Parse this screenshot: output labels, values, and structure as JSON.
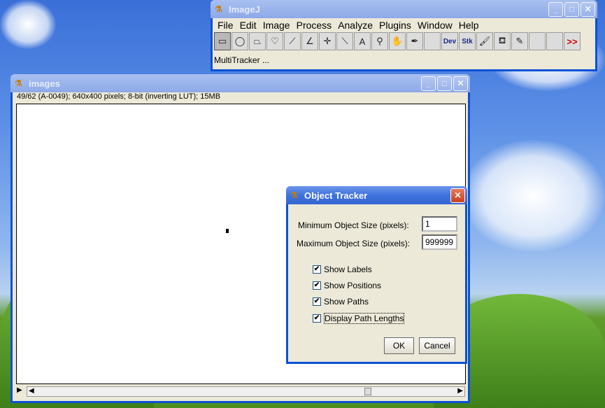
{
  "imagej": {
    "title": "ImageJ",
    "menu": [
      "File",
      "Edit",
      "Image",
      "Process",
      "Analyze",
      "Plugins",
      "Window",
      "Help"
    ],
    "tools": [
      {
        "name": "rectangle-tool-icon",
        "glyph": "▭",
        "sel": true
      },
      {
        "name": "oval-tool-icon",
        "glyph": "◯"
      },
      {
        "name": "polygon-tool-icon",
        "glyph": "⏢"
      },
      {
        "name": "freehand-tool-icon",
        "glyph": "♡"
      },
      {
        "name": "line-tool-icon",
        "glyph": "⟋"
      },
      {
        "name": "angle-tool-icon",
        "glyph": "∠"
      },
      {
        "name": "point-tool-icon",
        "glyph": "✛"
      },
      {
        "name": "wand-tool-icon",
        "glyph": "⟍"
      },
      {
        "name": "text-tool-icon",
        "glyph": "A"
      },
      {
        "name": "magnifier-tool-icon",
        "glyph": "⚲"
      },
      {
        "name": "hand-tool-icon",
        "glyph": "✋"
      },
      {
        "name": "dropper-tool-icon",
        "glyph": "✒"
      },
      {
        "name": "empty-tool",
        "glyph": ""
      },
      {
        "name": "dev-tool",
        "glyph": "Dev",
        "txt": true
      },
      {
        "name": "stk-tool",
        "glyph": "Stk",
        "txt": true
      },
      {
        "name": "brush-tool-icon",
        "glyph": "🖌"
      },
      {
        "name": "flood-fill-tool-icon",
        "glyph": "⛾"
      },
      {
        "name": "pencil-tool-icon",
        "glyph": "✎"
      },
      {
        "name": "empty-tool",
        "glyph": ""
      },
      {
        "name": "empty-tool",
        "glyph": ""
      },
      {
        "name": "more-tools-icon",
        "glyph": ">>",
        "more": true
      }
    ],
    "status": "MultiTracker ..."
  },
  "image_window": {
    "title": "images",
    "info": "49/62 (A-0049); 640x400 pixels; 8-bit (inverting LUT); 15MB"
  },
  "dialog": {
    "title": "Object Tracker",
    "min_label": "Minimum Object Size (pixels):",
    "min_value": "1",
    "max_label": "Maximum Object Size (pixels):",
    "max_value": "999999",
    "checkboxes": [
      {
        "label": "Show Labels",
        "checked": true
      },
      {
        "label": "Show Positions",
        "checked": true
      },
      {
        "label": "Show Paths",
        "checked": true
      },
      {
        "label": "Display Path Lengths",
        "checked": true
      }
    ],
    "ok": "OK",
    "cancel": "Cancel"
  }
}
